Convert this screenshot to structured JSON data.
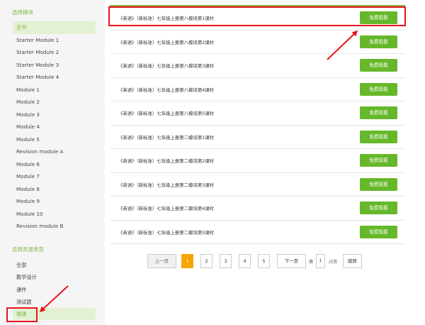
{
  "sidebar": {
    "module_section_title": "选择模块",
    "modules": [
      {
        "label": "全书",
        "active": true
      },
      {
        "label": "Starter Module 1"
      },
      {
        "label": "Starter Module 2"
      },
      {
        "label": "Starter Module 3"
      },
      {
        "label": "Starter Module 4"
      },
      {
        "label": "Module 1"
      },
      {
        "label": "Module 2"
      },
      {
        "label": "Module 3"
      },
      {
        "label": "Module 4"
      },
      {
        "label": "Module 5"
      },
      {
        "label": "Revision module A"
      },
      {
        "label": "Module 6"
      },
      {
        "label": "Module 7"
      },
      {
        "label": "Module 8"
      },
      {
        "label": "Module 9"
      },
      {
        "label": "Module 10"
      },
      {
        "label": "Revision module B"
      }
    ],
    "resource_section_title": "选择资源类型",
    "resource_types": [
      {
        "label": "全部"
      },
      {
        "label": "教学设计"
      },
      {
        "label": "课件"
      },
      {
        "label": "测试题"
      },
      {
        "label": "微课",
        "active": true
      }
    ]
  },
  "lessons": [
    {
      "title": "《英语》（新标准）七年级上册第八模块第1课时",
      "button": "免费观看"
    },
    {
      "title": "《英语》（新标准）七年级上册第八模块第2课时",
      "button": "免费观看"
    },
    {
      "title": "《英语》（新标准）七年级上册第八模块第3课时",
      "button": "免费观看"
    },
    {
      "title": "《英语》（新标准）七年级上册第八模块第4课时",
      "button": "免费观看"
    },
    {
      "title": "《英语》（新标准）七年级上册第八模块第5课时",
      "button": "免费观看"
    },
    {
      "title": "《英语》（新标准）七年级上册第二模块第1课时",
      "button": "免费观看"
    },
    {
      "title": "《英语》（新标准）七年级上册第二模块第2课时",
      "button": "免费观看"
    },
    {
      "title": "《英语》（新标准）七年级上册第二模块第3课时",
      "button": "免费观看"
    },
    {
      "title": "《英语》（新标准）七年级上册第二模块第4课时",
      "button": "免费观看"
    },
    {
      "title": "《英语》（新标准）七年级上册第二模块第5课时",
      "button": "免费观看"
    }
  ],
  "pagination": {
    "prev": "上一页",
    "pages": [
      "1",
      "2",
      "3",
      "4",
      "5"
    ],
    "current": "1",
    "next": "下一页",
    "goto_prefix": "第",
    "goto_value": "1",
    "total": "/5页",
    "go": "跳转"
  },
  "colors": {
    "accent_green": "#7fb944",
    "button_green": "#66b82a",
    "current_page_orange": "#f7a500",
    "annotation_red": "#e8141a"
  }
}
